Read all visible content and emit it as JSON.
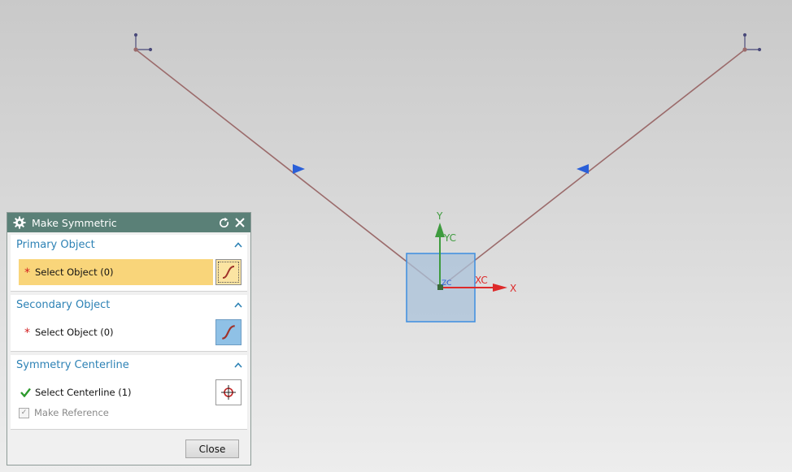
{
  "dialog": {
    "title": "Make Symmetric",
    "primary": {
      "header": "Primary Object",
      "select_label": "Select Object (0)"
    },
    "secondary": {
      "header": "Secondary Object",
      "select_label": "Select Object (0)"
    },
    "centerline": {
      "header": "Symmetry Centerline",
      "select_label": "Select Centerline (1)",
      "make_reference": "Make Reference"
    },
    "close_label": "Close"
  },
  "viewport": {
    "axis_labels": {
      "y": "Y",
      "yc": "YC",
      "x": "X",
      "xc": "XC",
      "zc": "ZC"
    }
  },
  "colors": {
    "title_bar": "#5a8077",
    "group_header": "#2d82b5",
    "active_selection": "#f9d57a",
    "sketch_line": "#9b6b6b",
    "marker": "#2a5fd8",
    "x_axis": "#dd2a2a",
    "y_axis": "#3e9b3e",
    "datum_plane": "#a9c1d9"
  }
}
